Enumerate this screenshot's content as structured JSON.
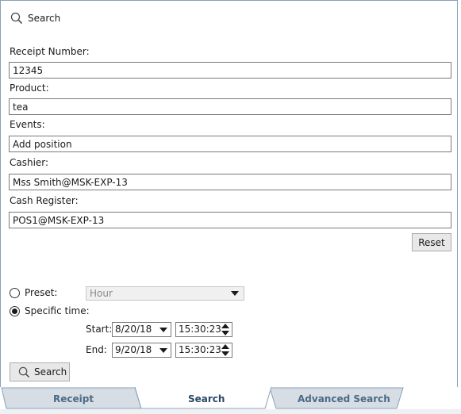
{
  "header": {
    "title": "Search",
    "icon": "search-icon"
  },
  "fields": {
    "receipt_number": {
      "label": "Receipt Number:",
      "value": "12345"
    },
    "product": {
      "label": "Product:",
      "value": "tea"
    },
    "events": {
      "label": "Events:",
      "value": "Add position"
    },
    "cashier": {
      "label": "Cashier:",
      "value": "Mss Smith@MSK-EXP-13"
    },
    "cash_register": {
      "label": "Cash Register:",
      "value": "POS1@MSK-EXP-13"
    }
  },
  "reset_label": "Reset",
  "time": {
    "preset": {
      "label": "Preset:",
      "selected": false,
      "value": "Hour"
    },
    "specific": {
      "label": "Specific time:",
      "selected": true
    },
    "start": {
      "label": "Start:",
      "date": "8/20/18",
      "time": "15:30:23"
    },
    "end": {
      "label": "End:",
      "date": "9/20/18",
      "time": "15:30:23"
    }
  },
  "search_button_label": "Search",
  "tabs": [
    {
      "label": "Receipt",
      "active": false
    },
    {
      "label": "Search",
      "active": true
    },
    {
      "label": "Advanced Search",
      "active": false
    }
  ],
  "colors": {
    "tab_inactive": "#d6dde5",
    "tab_active": "#ffffff",
    "tab_text": "#4a6a86",
    "border": "#8aa0b8"
  }
}
